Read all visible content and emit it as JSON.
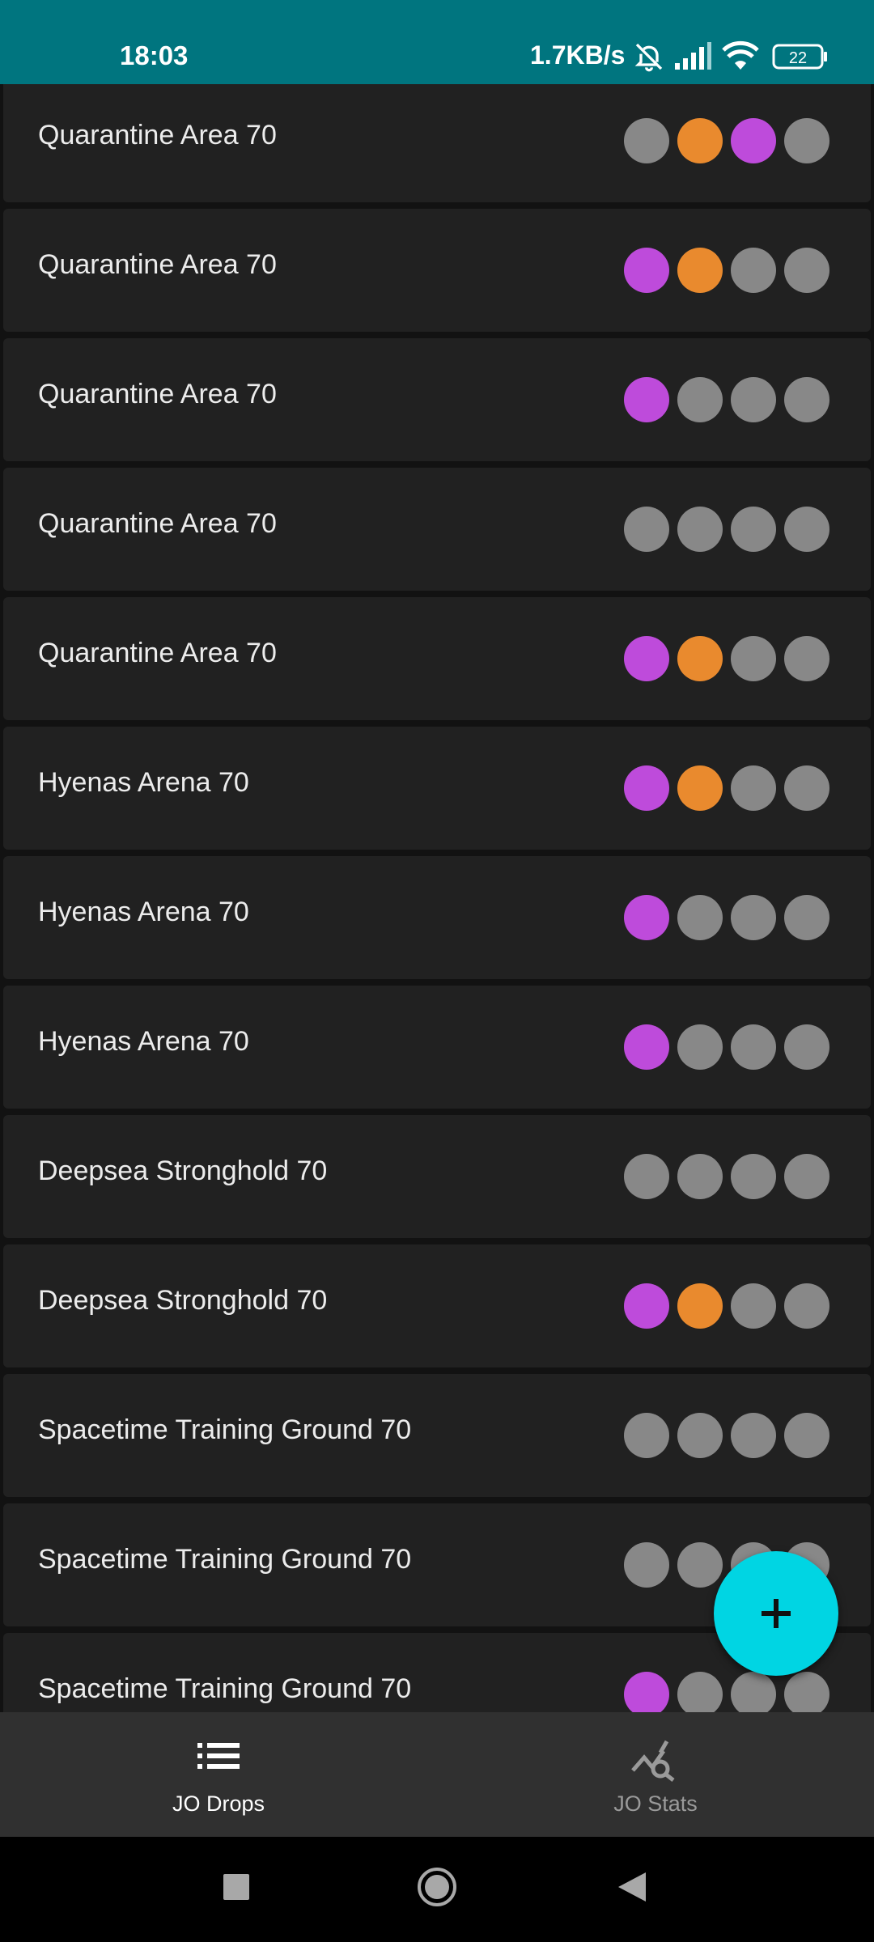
{
  "status_bar": {
    "time": "18:03",
    "network_speed": "1.7KB/s",
    "battery": "22",
    "icons": [
      "bell-off-icon",
      "cellular-signal-icon",
      "wifi-icon",
      "battery-icon"
    ]
  },
  "colors": {
    "status_bar": "#00757f",
    "item_background": "#212121",
    "dot_gray": "#888888",
    "dot_orange": "#e98a2e",
    "dot_purple": "#be4bdb",
    "fab": "#00d5e3"
  },
  "drops": [
    {
      "name": "Quarantine Area 70",
      "dots": [
        "gray",
        "orange",
        "purple",
        "gray"
      ]
    },
    {
      "name": "Quarantine Area 70",
      "dots": [
        "purple",
        "orange",
        "gray",
        "gray"
      ]
    },
    {
      "name": "Quarantine Area 70",
      "dots": [
        "purple",
        "gray",
        "gray",
        "gray"
      ]
    },
    {
      "name": "Quarantine Area 70",
      "dots": [
        "gray",
        "gray",
        "gray",
        "gray"
      ]
    },
    {
      "name": "Quarantine Area 70",
      "dots": [
        "purple",
        "orange",
        "gray",
        "gray"
      ]
    },
    {
      "name": "Hyenas Arena 70",
      "dots": [
        "purple",
        "orange",
        "gray",
        "gray"
      ]
    },
    {
      "name": "Hyenas Arena 70",
      "dots": [
        "purple",
        "gray",
        "gray",
        "gray"
      ]
    },
    {
      "name": "Hyenas Arena 70",
      "dots": [
        "purple",
        "gray",
        "gray",
        "gray"
      ]
    },
    {
      "name": "Deepsea Stronghold 70",
      "dots": [
        "gray",
        "gray",
        "gray",
        "gray"
      ]
    },
    {
      "name": "Deepsea Stronghold 70",
      "dots": [
        "purple",
        "orange",
        "gray",
        "gray"
      ]
    },
    {
      "name": "Spacetime Training Ground 70",
      "dots": [
        "gray",
        "gray",
        "gray",
        "gray"
      ]
    },
    {
      "name": "Spacetime Training Ground 70",
      "dots": [
        "gray",
        "gray",
        "gray",
        "gray"
      ]
    },
    {
      "name": "Spacetime Training Ground 70",
      "dots": [
        "purple",
        "gray",
        "gray",
        "gray"
      ]
    }
  ],
  "fab": {
    "icon": "plus-icon"
  },
  "bottom_nav": {
    "tabs": [
      {
        "label": "JO Drops",
        "icon": "list-icon",
        "active": true
      },
      {
        "label": "JO Stats",
        "icon": "stats-search-icon",
        "active": false
      }
    ]
  },
  "system_nav": {
    "icons": [
      "recents-square-icon",
      "home-circle-icon",
      "back-triangle-icon"
    ]
  }
}
